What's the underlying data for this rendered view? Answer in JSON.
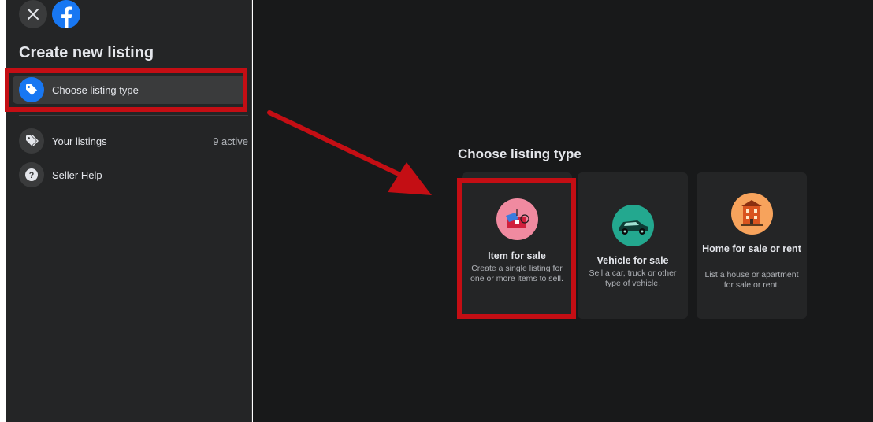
{
  "sidebar": {
    "title": "Create new listing",
    "nav": [
      {
        "label": "Choose listing type",
        "icon": "tag-icon",
        "active": true
      },
      {
        "label": "Your listings",
        "icon": "tags-icon",
        "meta": "9 active"
      },
      {
        "label": "Seller Help",
        "icon": "help-icon"
      }
    ]
  },
  "main": {
    "section_title": "Choose listing type",
    "cards": [
      {
        "title": "Item for sale",
        "description": "Create a single listing for one or more items to sell.",
        "icon": "item-for-sale-icon",
        "icon_bg": "#f08aa0"
      },
      {
        "title": "Vehicle for sale",
        "description": "Sell a car, truck or other type of vehicle.",
        "icon": "car-icon",
        "icon_bg": "#23a88f"
      },
      {
        "title": "Home for sale or rent",
        "description": "List a house or apartment for sale or rent.",
        "icon": "house-icon",
        "icon_bg": "#f7a35c"
      }
    ]
  },
  "colors": {
    "annotation_red": "#c40e14",
    "facebook_blue": "#1877f2",
    "panel_bg": "#242526",
    "main_bg": "#18191a"
  }
}
